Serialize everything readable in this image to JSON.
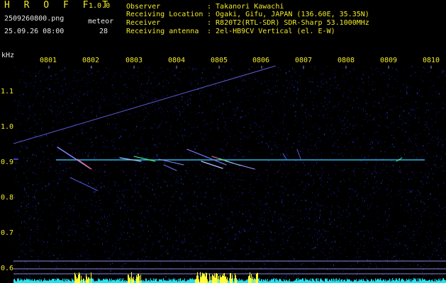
{
  "header": {
    "brand": "H R O F F T",
    "version": "1.0.0",
    "filename": "2509260800.png",
    "datetime": "25.09.26 08:00",
    "meteor_label": "meteor",
    "meteor_count": "28"
  },
  "info": {
    "observer_label": "Observer",
    "observer_value": ": Takanori Kawachi",
    "location_label": "Receiving Location",
    "location_value": ": Ogaki, Gifu, JAPAN (136.60E, 35.35N)",
    "receiver_label": "Receiver",
    "receiver_value": ": R820T2(RTL-SDR) SDR-Sharp 53.1000MHz",
    "antenna_label": "Receiving antenna",
    "antenna_value": ": 2el-HB9CV Vertical (el. E-W)"
  },
  "axis": {
    "unit": "kHz",
    "x_ticks": [
      "0801",
      "0802",
      "0803",
      "0804",
      "0805",
      "0806",
      "0807",
      "0808",
      "0809",
      "0810"
    ],
    "y_ticks": [
      "1.1",
      "1.0",
      "0.9",
      "0.8",
      "0.7",
      "0.6"
    ]
  },
  "colors": {
    "background": "#000000",
    "text_yellow": "#f2ea2a",
    "text_white": "#e8e8e8",
    "noise_blue": "#1a1a9a",
    "signal_cyan": "#30f0ff",
    "bars_cyan": "#22e0ee",
    "bars_yellow": "#ffff33"
  }
}
